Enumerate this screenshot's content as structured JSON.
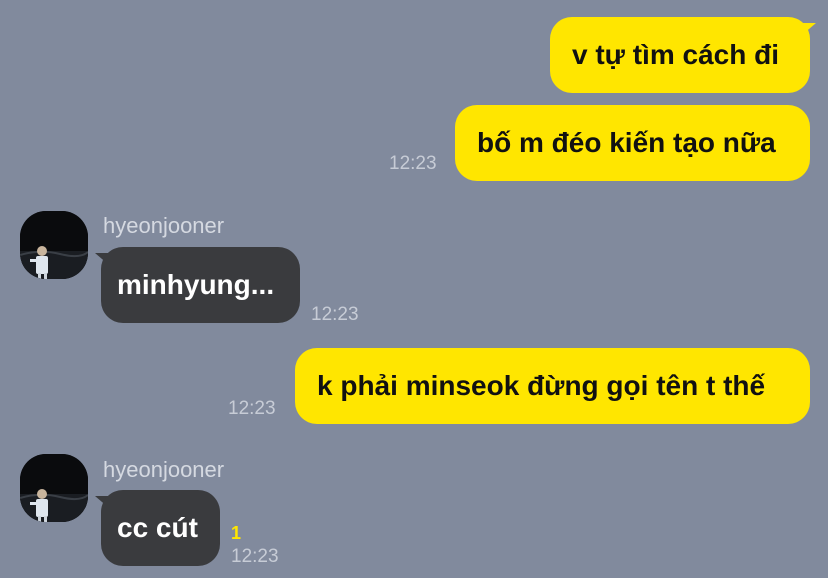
{
  "messages": [
    {
      "side": "out",
      "text": "v tự tìm cách đi"
    },
    {
      "side": "out",
      "text": "bố m đéo kiến tạo nữa",
      "time": "12:23"
    },
    {
      "side": "in",
      "sender": "hyeonjooner",
      "text": "minhyung...",
      "time": "12:23"
    },
    {
      "side": "out",
      "text": "k phải minseok đừng gọi tên t thế",
      "time": "12:23"
    },
    {
      "side": "in",
      "sender": "hyeonjooner",
      "text": "cc cút",
      "time": "12:23",
      "unread": "1"
    }
  ],
  "colors": {
    "background": "#818a9d",
    "outgoing_bubble": "#ffe600",
    "incoming_bubble": "#3a3b3e",
    "unread_count": "#ffe600"
  },
  "icons": {
    "avatar": "profile-photo-avatar"
  }
}
